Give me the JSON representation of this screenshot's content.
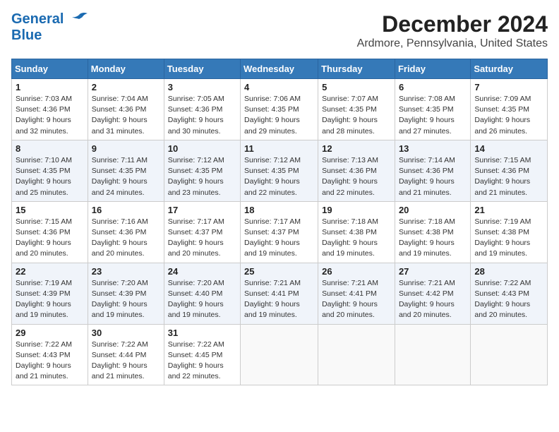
{
  "logo": {
    "line1": "General",
    "line2": "Blue"
  },
  "title": "December 2024",
  "subtitle": "Ardmore, Pennsylvania, United States",
  "days_of_week": [
    "Sunday",
    "Monday",
    "Tuesday",
    "Wednesday",
    "Thursday",
    "Friday",
    "Saturday"
  ],
  "weeks": [
    [
      {
        "day": 1,
        "sunrise": "7:03 AM",
        "sunset": "4:36 PM",
        "daylight": "9 hours and 32 minutes"
      },
      {
        "day": 2,
        "sunrise": "7:04 AM",
        "sunset": "4:36 PM",
        "daylight": "9 hours and 31 minutes"
      },
      {
        "day": 3,
        "sunrise": "7:05 AM",
        "sunset": "4:36 PM",
        "daylight": "9 hours and 30 minutes"
      },
      {
        "day": 4,
        "sunrise": "7:06 AM",
        "sunset": "4:35 PM",
        "daylight": "9 hours and 29 minutes"
      },
      {
        "day": 5,
        "sunrise": "7:07 AM",
        "sunset": "4:35 PM",
        "daylight": "9 hours and 28 minutes"
      },
      {
        "day": 6,
        "sunrise": "7:08 AM",
        "sunset": "4:35 PM",
        "daylight": "9 hours and 27 minutes"
      },
      {
        "day": 7,
        "sunrise": "7:09 AM",
        "sunset": "4:35 PM",
        "daylight": "9 hours and 26 minutes"
      }
    ],
    [
      {
        "day": 8,
        "sunrise": "7:10 AM",
        "sunset": "4:35 PM",
        "daylight": "9 hours and 25 minutes"
      },
      {
        "day": 9,
        "sunrise": "7:11 AM",
        "sunset": "4:35 PM",
        "daylight": "9 hours and 24 minutes"
      },
      {
        "day": 10,
        "sunrise": "7:12 AM",
        "sunset": "4:35 PM",
        "daylight": "9 hours and 23 minutes"
      },
      {
        "day": 11,
        "sunrise": "7:12 AM",
        "sunset": "4:35 PM",
        "daylight": "9 hours and 22 minutes"
      },
      {
        "day": 12,
        "sunrise": "7:13 AM",
        "sunset": "4:36 PM",
        "daylight": "9 hours and 22 minutes"
      },
      {
        "day": 13,
        "sunrise": "7:14 AM",
        "sunset": "4:36 PM",
        "daylight": "9 hours and 21 minutes"
      },
      {
        "day": 14,
        "sunrise": "7:15 AM",
        "sunset": "4:36 PM",
        "daylight": "9 hours and 21 minutes"
      }
    ],
    [
      {
        "day": 15,
        "sunrise": "7:15 AM",
        "sunset": "4:36 PM",
        "daylight": "9 hours and 20 minutes"
      },
      {
        "day": 16,
        "sunrise": "7:16 AM",
        "sunset": "4:36 PM",
        "daylight": "9 hours and 20 minutes"
      },
      {
        "day": 17,
        "sunrise": "7:17 AM",
        "sunset": "4:37 PM",
        "daylight": "9 hours and 20 minutes"
      },
      {
        "day": 18,
        "sunrise": "7:17 AM",
        "sunset": "4:37 PM",
        "daylight": "9 hours and 19 minutes"
      },
      {
        "day": 19,
        "sunrise": "7:18 AM",
        "sunset": "4:38 PM",
        "daylight": "9 hours and 19 minutes"
      },
      {
        "day": 20,
        "sunrise": "7:18 AM",
        "sunset": "4:38 PM",
        "daylight": "9 hours and 19 minutes"
      },
      {
        "day": 21,
        "sunrise": "7:19 AM",
        "sunset": "4:38 PM",
        "daylight": "9 hours and 19 minutes"
      }
    ],
    [
      {
        "day": 22,
        "sunrise": "7:19 AM",
        "sunset": "4:39 PM",
        "daylight": "9 hours and 19 minutes"
      },
      {
        "day": 23,
        "sunrise": "7:20 AM",
        "sunset": "4:39 PM",
        "daylight": "9 hours and 19 minutes"
      },
      {
        "day": 24,
        "sunrise": "7:20 AM",
        "sunset": "4:40 PM",
        "daylight": "9 hours and 19 minutes"
      },
      {
        "day": 25,
        "sunrise": "7:21 AM",
        "sunset": "4:41 PM",
        "daylight": "9 hours and 19 minutes"
      },
      {
        "day": 26,
        "sunrise": "7:21 AM",
        "sunset": "4:41 PM",
        "daylight": "9 hours and 20 minutes"
      },
      {
        "day": 27,
        "sunrise": "7:21 AM",
        "sunset": "4:42 PM",
        "daylight": "9 hours and 20 minutes"
      },
      {
        "day": 28,
        "sunrise": "7:22 AM",
        "sunset": "4:43 PM",
        "daylight": "9 hours and 20 minutes"
      }
    ],
    [
      {
        "day": 29,
        "sunrise": "7:22 AM",
        "sunset": "4:43 PM",
        "daylight": "9 hours and 21 minutes"
      },
      {
        "day": 30,
        "sunrise": "7:22 AM",
        "sunset": "4:44 PM",
        "daylight": "9 hours and 21 minutes"
      },
      {
        "day": 31,
        "sunrise": "7:22 AM",
        "sunset": "4:45 PM",
        "daylight": "9 hours and 22 minutes"
      },
      null,
      null,
      null,
      null
    ]
  ]
}
